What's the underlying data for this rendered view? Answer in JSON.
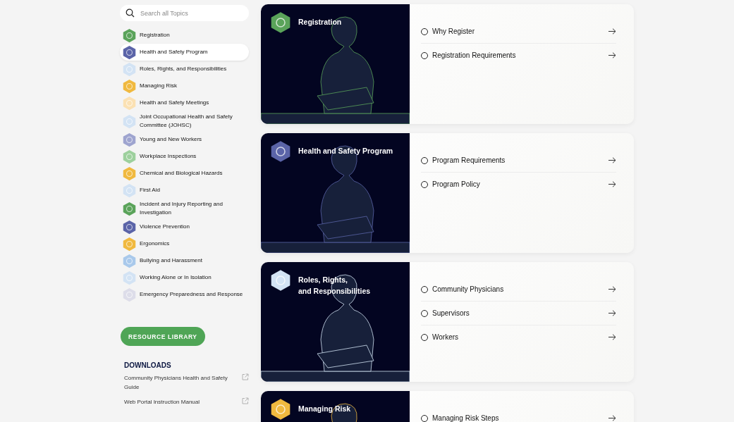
{
  "search": {
    "placeholder": "Search all Topics"
  },
  "topics": [
    {
      "label": "Registration",
      "color": "#5aa35a",
      "selected": false
    },
    {
      "label": "Health and Safety Program",
      "color": "#5b64a8",
      "selected": true
    },
    {
      "label": "Roles, Rights, and Responsibilities",
      "color": "#d3e3f4",
      "selected": false
    },
    {
      "label": "Managing Risk",
      "color": "#f0b93f",
      "selected": false
    },
    {
      "label": "Health and Safety Meetings",
      "color": "#fbe1b3",
      "selected": false
    },
    {
      "label": "Joint Occupational Health and Safety Committee (JOHSC)",
      "color": "#d3e3f4",
      "selected": false
    },
    {
      "label": "Young and New Workers",
      "color": "#9ea4cf",
      "selected": false
    },
    {
      "label": "Workplace Inspections",
      "color": "#9dd09d",
      "selected": false
    },
    {
      "label": "Chemical and Biological Hazards",
      "color": "#f0b93f",
      "selected": false
    },
    {
      "label": "First Aid",
      "color": "#d3e3f4",
      "selected": false
    },
    {
      "label": "Incident and Injury Reporting and Investigation",
      "color": "#5aa35a",
      "selected": false
    },
    {
      "label": "Violence Prevention",
      "color": "#5b64a8",
      "selected": false
    },
    {
      "label": "Ergonomics",
      "color": "#f0b93f",
      "selected": false
    },
    {
      "label": "Bullying and Harassment",
      "color": "#a9c9eb",
      "selected": false
    },
    {
      "label": "Working Alone or In Isolation",
      "color": "#d3e3f4",
      "selected": false
    },
    {
      "label": "Emergency Preparedness and Response",
      "color": "#dddde9",
      "selected": false
    }
  ],
  "resource_button": "RESOURCE LIBRARY",
  "downloads": {
    "heading": "DOWNLOADS",
    "links": [
      "Community Physicians Health and Safety Guide",
      "Web Portal Instruction Manual"
    ]
  },
  "cards": [
    {
      "title_lines": [
        "Registration"
      ],
      "color": "#5aa35a",
      "links": [
        {
          "label": "Why Register",
          "checked": false
        },
        {
          "label": "Registration Requirements",
          "checked": false
        }
      ]
    },
    {
      "title_lines": [
        "Health and Safety Program"
      ],
      "color": "#5b64a8",
      "links": [
        {
          "label": "Program Requirements",
          "checked": false
        },
        {
          "label": "Program Policy",
          "checked": false
        }
      ]
    },
    {
      "title_lines": [
        "Roles, Rights,",
        "and Responsibilities"
      ],
      "color": "#d3e3f4",
      "links": [
        {
          "label": "Community Physicians",
          "checked": false
        },
        {
          "label": "Supervisors",
          "checked": false
        },
        {
          "label": "Workers",
          "checked": false
        }
      ]
    },
    {
      "title_lines": [
        "Managing Risk"
      ],
      "color": "#f0b93f",
      "links": [
        {
          "label": "Managing Risk Steps",
          "checked": false
        }
      ]
    }
  ]
}
